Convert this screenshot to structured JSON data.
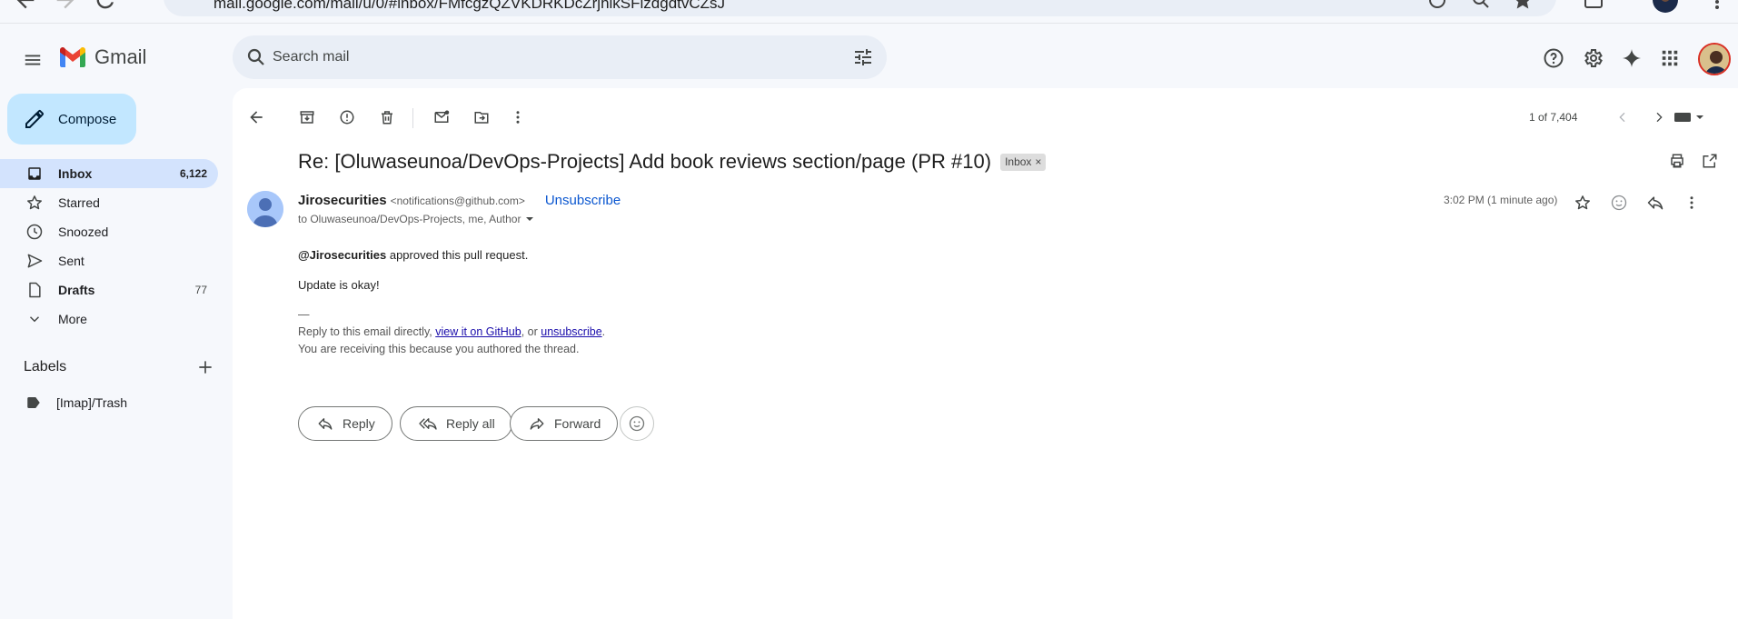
{
  "browser": {
    "url": "mail.google.com/mail/u/0/#inbox/FMfcgzQZVKDRKDcZrjhlkSFlzdgdtvCZsJ"
  },
  "header": {
    "app_name": "Gmail",
    "search": {
      "placeholder": "Search mail"
    }
  },
  "sidebar": {
    "compose_label": "Compose",
    "items": [
      {
        "label": "Inbox",
        "count": "6,122"
      },
      {
        "label": "Starred",
        "count": ""
      },
      {
        "label": "Snoozed",
        "count": ""
      },
      {
        "label": "Sent",
        "count": ""
      },
      {
        "label": "Drafts",
        "count": "77"
      },
      {
        "label": "More",
        "count": ""
      }
    ],
    "labels_title": "Labels",
    "labels": [
      {
        "label": "[Imap]/Trash"
      }
    ]
  },
  "toolbar": {
    "pager": "1 of 7,404"
  },
  "message": {
    "subject": "Re: [Oluwaseunoa/DevOps-Projects] Add book reviews section/page (PR #10)",
    "chip_label": "Inbox",
    "chip_close": "×",
    "sender_name": "Jirosecurities",
    "sender_email": "<notifications@github.com>",
    "unsubscribe": "Unsubscribe",
    "to_line": "to Oluwaseunoa/DevOps-Projects, me, Author",
    "time": "3:02 PM (1 minute ago)",
    "body": {
      "mention": "@Jirosecurities",
      "approved_text": " approved this pull request.",
      "update_text": "Update is okay!",
      "dash": "—",
      "reply_prefix": "Reply to this email directly, ",
      "view_link": "view it on GitHub",
      "reply_mid": ", or ",
      "unsub_link": "unsubscribe",
      "reply_suffix": ".",
      "receiving_text": "You are receiving this because you authored the thread."
    }
  },
  "actions": {
    "reply": "Reply",
    "reply_all": "Reply all",
    "forward": "Forward"
  },
  "colors": {
    "accent": "#0b57d0",
    "compose_bg": "#c2e7ff",
    "active_nav_bg": "#d3e3fd",
    "page_bg": "#f6f8fc"
  }
}
